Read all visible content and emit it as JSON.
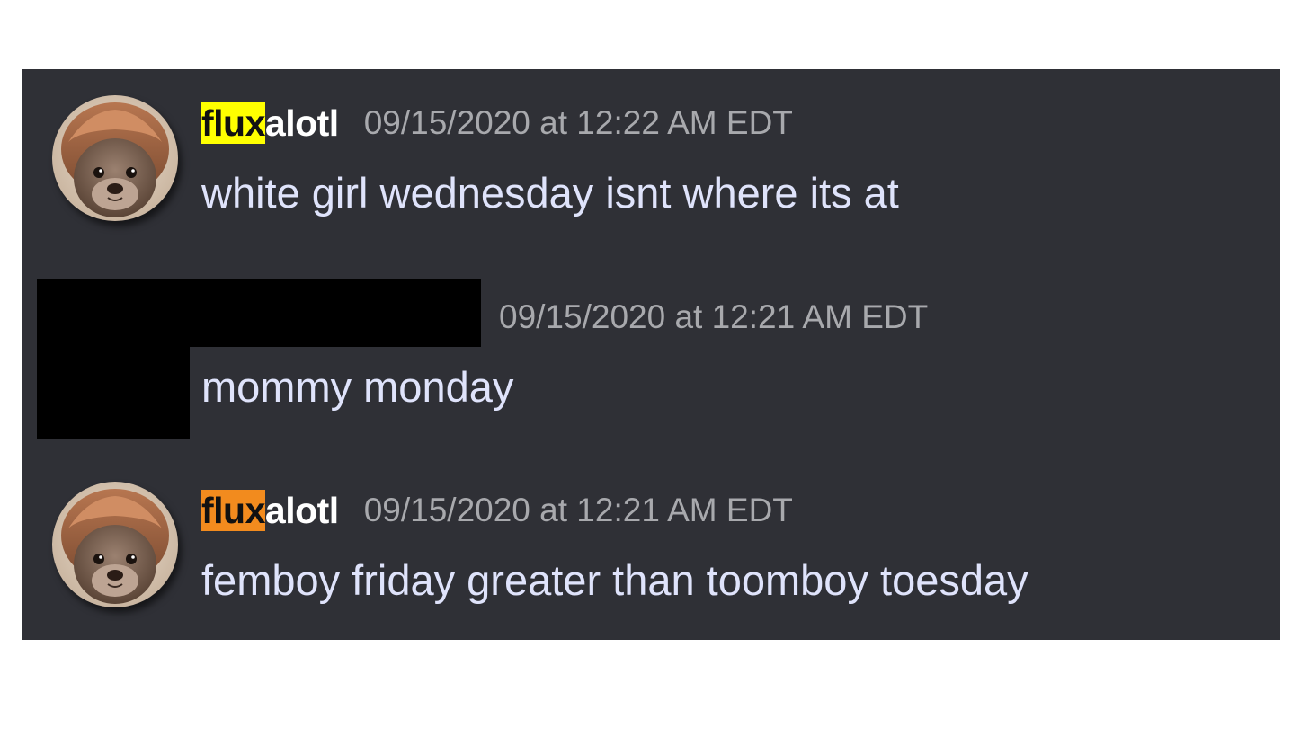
{
  "colors": {
    "panel_background": "#2f3036",
    "message_text": "#dfe3fb",
    "timestamp_text": "#a8a9ad",
    "username_text": "#ffffff",
    "highlight_yellow": "#ffff00",
    "highlight_orange": "#f28b1e",
    "redaction": "#000000"
  },
  "messages": [
    {
      "username_highlight": "flux",
      "username_rest": "alotl",
      "highlight_color": "yellow",
      "timestamp": "09/15/2020 at 12:22 AM EDT",
      "text": "white girl wednesday isnt where its at",
      "avatar_icon": "otter-avatar-icon"
    },
    {
      "username_highlight": "",
      "username_rest": "",
      "redacted": true,
      "timestamp": "09/15/2020 at 12:21 AM EDT",
      "text": "mommy monday",
      "avatar_icon": "redacted-avatar"
    },
    {
      "username_highlight": "flux",
      "username_rest": "alotl",
      "highlight_color": "orange",
      "timestamp": "09/15/2020 at 12:21 AM EDT",
      "text": "femboy friday greater than toomboy toesday",
      "avatar_icon": "otter-avatar-icon"
    }
  ]
}
